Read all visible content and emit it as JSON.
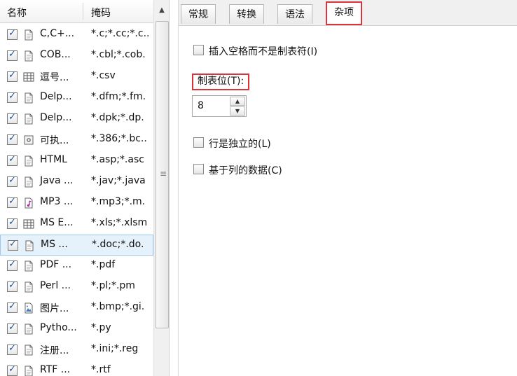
{
  "left_panel": {
    "columns": [
      "名称",
      "掩码"
    ],
    "rows": [
      {
        "name": "C,C+...",
        "mask": "*.c;*.cc;*.c..",
        "icon": "document-icon"
      },
      {
        "name": "COB...",
        "mask": "*.cbl;*.cob.",
        "icon": "document-icon"
      },
      {
        "name": "逗号...",
        "mask": "*.csv",
        "icon": "table-icon"
      },
      {
        "name": "Delp...",
        "mask": "*.dfm;*.fm.",
        "icon": "document-icon"
      },
      {
        "name": "Delp...",
        "mask": "*.dpk;*.dp.",
        "icon": "document-icon"
      },
      {
        "name": "可执...",
        "mask": "*.386;*.bc..",
        "icon": "gear-icon"
      },
      {
        "name": "HTML",
        "mask": "*.asp;*.asc",
        "icon": "document-icon"
      },
      {
        "name": "Java ...",
        "mask": "*.jav;*.java",
        "icon": "document-icon"
      },
      {
        "name": "MP3 ...",
        "mask": "*.mp3;*.m.",
        "icon": "music-icon"
      },
      {
        "name": "MS E...",
        "mask": "*.xls;*.xlsm",
        "icon": "table-icon"
      },
      {
        "name": "MS ...",
        "mask": "*.doc;*.do.",
        "icon": "document-icon",
        "selected": true
      },
      {
        "name": "PDF ...",
        "mask": "*.pdf",
        "icon": "document-icon"
      },
      {
        "name": "Perl ...",
        "mask": "*.pl;*.pm",
        "icon": "document-icon"
      },
      {
        "name": "图片...",
        "mask": "*.bmp;*.gi.",
        "icon": "image-icon"
      },
      {
        "name": "Pytho...",
        "mask": "*.py",
        "icon": "document-icon"
      },
      {
        "name": "注册...",
        "mask": "*.ini;*.reg",
        "icon": "document-icon"
      },
      {
        "name": "RTF ...",
        "mask": "*.rtf",
        "icon": "document-icon"
      }
    ]
  },
  "tabs": [
    "常规",
    "转换",
    "语法",
    "杂项"
  ],
  "active_tab": "杂项",
  "options": {
    "insert_spaces": "插入空格而不是制表符(I)",
    "tab_position_label": "制表位(T):",
    "tab_position_value": "8",
    "row_independent": "行是独立的(L)",
    "column_based": "基于列的数据(C)"
  }
}
